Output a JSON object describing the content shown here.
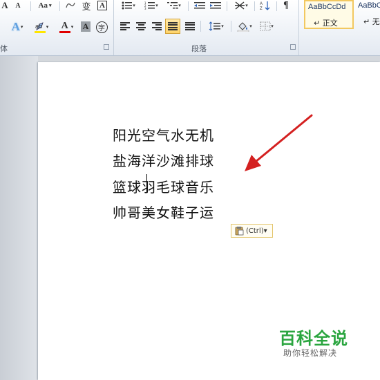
{
  "ribbon": {
    "font_group_label": "体",
    "paragraph_group_label": "段落",
    "font_buttons": {
      "font_size_up": "A",
      "font_size_down": "A",
      "change_case": "Aa",
      "clear_format": "A",
      "font_color": "A",
      "char_shading": "A",
      "enclose_char": "字"
    },
    "styles": [
      {
        "sample": "AaBbCcDd",
        "name": "↵ 正文",
        "active": true
      },
      {
        "sample": "AaBbC",
        "name": "↵ 无间",
        "active": false
      }
    ]
  },
  "document": {
    "lines": [
      "阳光空气水无机",
      "盐海洋沙滩排球",
      "篮球羽毛球音乐",
      "帅哥美女鞋子运"
    ],
    "paste_options_label": "(Ctrl)▾"
  },
  "watermark": {
    "title": "百科全说",
    "subtitle": "助你轻松解决"
  },
  "colors": {
    "font_color_underline": "#e00000",
    "highlight_underline": "#ffe600",
    "annotation_arrow": "#d42020",
    "watermark_green": "#2aa53f"
  }
}
